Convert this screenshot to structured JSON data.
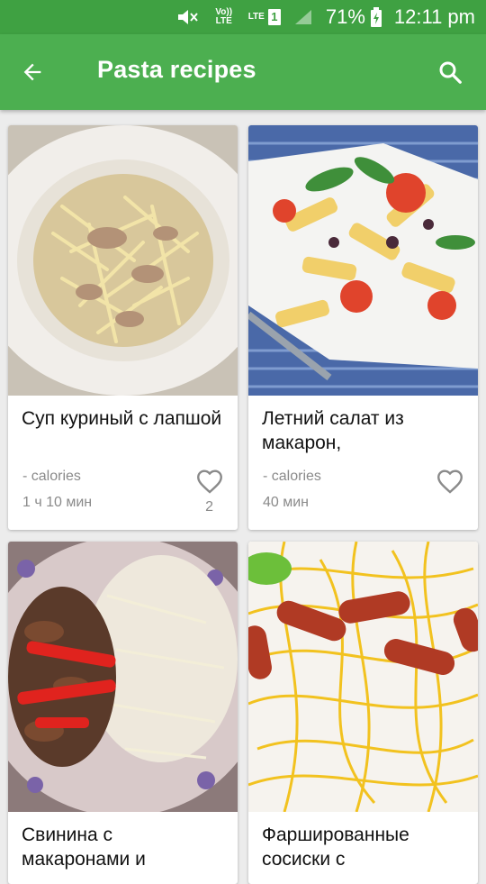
{
  "status": {
    "volte": "Vo)) LTE",
    "lte": "LTE",
    "sim": "1",
    "battery": "71%",
    "time": "12:11 pm"
  },
  "appbar": {
    "title": "Pasta recipes"
  },
  "recipes": [
    {
      "title": "Суп куриный с лапшой",
      "calories": "- calories",
      "time": "1 ч 10 мин",
      "likes": "2"
    },
    {
      "title": "Летний салат из макарон,",
      "calories": "- calories",
      "time": "40 мин",
      "likes": ""
    },
    {
      "title": "Свинина с макаронами и",
      "calories": "",
      "time": "",
      "likes": ""
    },
    {
      "title": "Фаршированные сосиски с",
      "calories": "",
      "time": "",
      "likes": ""
    }
  ],
  "colors": {
    "appbar": "#4caf50",
    "statusbar": "#3fa142"
  }
}
